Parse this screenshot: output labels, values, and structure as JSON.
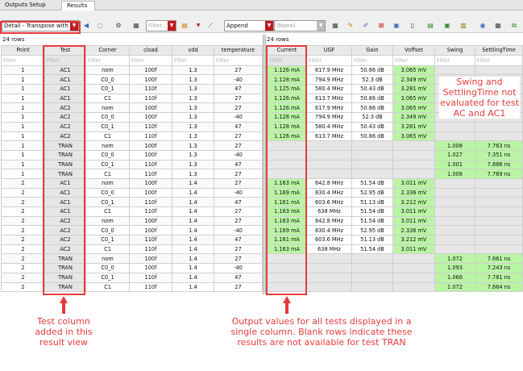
{
  "tabs": [
    "Outputs Setup",
    "Results"
  ],
  "toolbar": {
    "view_select": "Detail - Transpose with T",
    "filter_placeholder": "Filter...",
    "append_select": "Append",
    "none_select": "(None)"
  },
  "left_table": {
    "row_count": "24 rows",
    "columns": [
      "Point",
      "Test",
      "Corner",
      "cload",
      "vdd",
      "temperature"
    ],
    "filter_placeholder": "Filter",
    "rows": [
      [
        "1",
        "AC1",
        "nom",
        "100f",
        "1.3",
        "27"
      ],
      [
        "1",
        "AC1",
        "C0_0",
        "100f",
        "1.3",
        "-40"
      ],
      [
        "1",
        "AC1",
        "C0_1",
        "110f",
        "1.3",
        "47"
      ],
      [
        "1",
        "AC1",
        "C1",
        "110f",
        "1.3",
        "27"
      ],
      [
        "1",
        "AC2",
        "nom",
        "100f",
        "1.3",
        "27"
      ],
      [
        "1",
        "AC2",
        "C0_0",
        "100f",
        "1.3",
        "-40"
      ],
      [
        "1",
        "AC2",
        "C0_1",
        "110f",
        "1.3",
        "47"
      ],
      [
        "1",
        "AC2",
        "C1",
        "110f",
        "1.3",
        "27"
      ],
      [
        "1",
        "TRAN",
        "nom",
        "100f",
        "1.3",
        "27"
      ],
      [
        "1",
        "TRAN",
        "C0_0",
        "100f",
        "1.3",
        "-40"
      ],
      [
        "1",
        "TRAN",
        "C0_1",
        "110f",
        "1.3",
        "47"
      ],
      [
        "1",
        "TRAN",
        "C1",
        "110f",
        "1.3",
        "27"
      ],
      [
        "2",
        "AC1",
        "nom",
        "100f",
        "1.4",
        "27"
      ],
      [
        "2",
        "AC1",
        "C0_0",
        "100f",
        "1.4",
        "-40"
      ],
      [
        "2",
        "AC1",
        "C0_1",
        "110f",
        "1.4",
        "47"
      ],
      [
        "2",
        "AC1",
        "C1",
        "110f",
        "1.4",
        "27"
      ],
      [
        "2",
        "AC2",
        "nom",
        "100f",
        "1.4",
        "27"
      ],
      [
        "2",
        "AC2",
        "C0_0",
        "100f",
        "1.4",
        "-40"
      ],
      [
        "2",
        "AC2",
        "C0_1",
        "110f",
        "1.4",
        "47"
      ],
      [
        "2",
        "AC2",
        "C1",
        "110f",
        "1.4",
        "27"
      ],
      [
        "2",
        "TRAN",
        "nom",
        "100f",
        "1.4",
        "27"
      ],
      [
        "2",
        "TRAN",
        "C0_0",
        "100f",
        "1.4",
        "-40"
      ],
      [
        "2",
        "TRAN",
        "C0_1",
        "110f",
        "1.4",
        "47"
      ],
      [
        "2",
        "TRAN",
        "C1",
        "110f",
        "1.4",
        "27"
      ]
    ]
  },
  "right_table": {
    "row_count": "24 rows",
    "columns": [
      "Current",
      "UGF",
      "Gain",
      "Voffset",
      "Swing",
      "SettlingTime"
    ],
    "filter_placeholder": "Filter",
    "rows": [
      [
        "1.126 mA",
        "617.9 MHz",
        "50.86 dB",
        "3.065 mV",
        "",
        ""
      ],
      [
        "1.128 mA",
        "794.9 MHz",
        "52.3 dB",
        "2.349 mV",
        "",
        ""
      ],
      [
        "1.125 mA",
        "580.4 MHz",
        "50.43 dB",
        "3.281 mV",
        "",
        ""
      ],
      [
        "1.126 mA",
        "613.7 MHz",
        "50.86 dB",
        "3.065 mV",
        "",
        ""
      ],
      [
        "1.126 mA",
        "617.9 MHz",
        "50.86 dB",
        "3.065 mV",
        "",
        ""
      ],
      [
        "1.128 mA",
        "794.9 MHz",
        "52.3 dB",
        "2.349 mV",
        "",
        ""
      ],
      [
        "1.128 mA",
        "580.4 MHz",
        "50.43 dB",
        "3.281 mV",
        "",
        ""
      ],
      [
        "1.126 mA",
        "613.7 MHz",
        "50.86 dB",
        "3.065 mV",
        "",
        ""
      ],
      [
        "",
        "",
        "",
        "",
        "1.008",
        "7.763 ns"
      ],
      [
        "",
        "",
        "",
        "",
        "1.027",
        "7.351 ns"
      ],
      [
        "",
        "",
        "",
        "",
        "1.001",
        "7.886 ns"
      ],
      [
        "",
        "",
        "",
        "",
        "1.008",
        "7.769 ns"
      ],
      [
        "1.163 mA",
        "642.8 MHz",
        "51.54 dB",
        "3.011 mV",
        "",
        ""
      ],
      [
        "1.169 mA",
        "830.4 MHz",
        "52.95 dB",
        "2.336 mV",
        "",
        ""
      ],
      [
        "1.161 mA",
        "603.6 MHz",
        "51.13 dB",
        "3.212 mV",
        "",
        ""
      ],
      [
        "1.163 mA",
        "638 MHz",
        "51.54 dB",
        "3.011 mV",
        "",
        ""
      ],
      [
        "1.163 mA",
        "642.8 MHz",
        "51.54 dB",
        "3.011 mV",
        "",
        ""
      ],
      [
        "1.169 mA",
        "830.4 MHz",
        "52.95 dB",
        "2.336 mV",
        "",
        ""
      ],
      [
        "1.161 mA",
        "603.6 MHz",
        "51.13 dB",
        "3.212 mV",
        "",
        ""
      ],
      [
        "1.163 mA",
        "638 MHz",
        "51.54 dB",
        "3.011 mV",
        "",
        ""
      ],
      [
        "",
        "",
        "",
        "",
        "1.072",
        "7.661 ns"
      ],
      [
        "",
        "",
        "",
        "",
        "1.093",
        "7.243 ns"
      ],
      [
        "",
        "",
        "",
        "",
        "1.066",
        "7.781 ns"
      ],
      [
        "",
        "",
        "",
        "",
        "1.072",
        "7.664 ns"
      ]
    ]
  },
  "annotations": {
    "test_column": "Test column added in this result view",
    "output_values": "Output values for all tests displayed in a single column. Blank rows indicate these results are not available for test TRAN",
    "swing_note": "Swing and SettlingTime not evaluated for test AC and AC1"
  },
  "colors": {
    "highlight_green": "#b9f5a4",
    "annotation_red": "#e53b3b"
  }
}
